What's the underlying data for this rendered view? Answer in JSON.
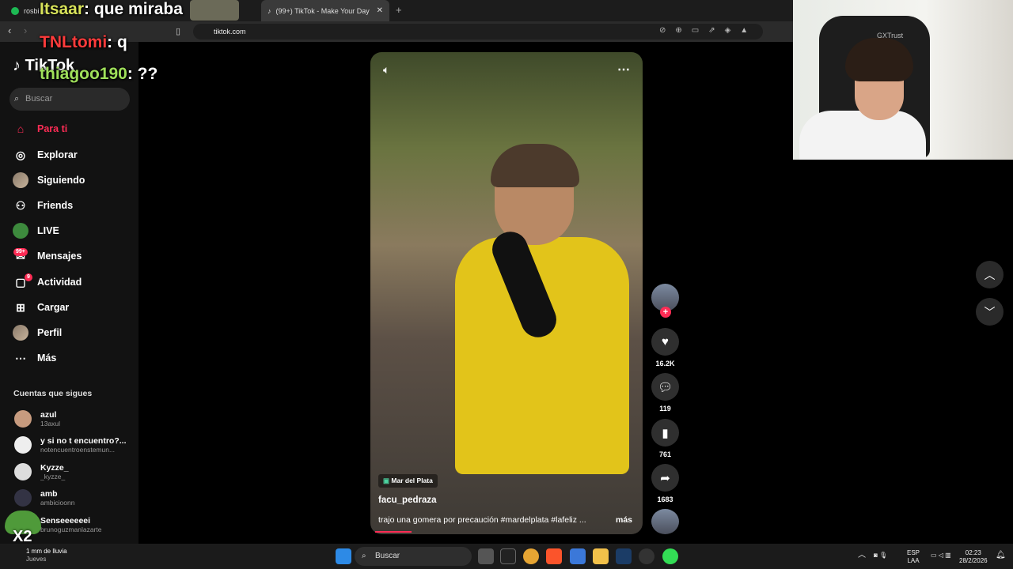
{
  "browser": {
    "tabs": [
      {
        "label": "rosbi p"
      },
      {
        "label": "(99+) TikTok - Make Your Day"
      }
    ],
    "url": "tiktok.com"
  },
  "chat_overlay": [
    {
      "user": "Itsaar",
      "message": ": que miraba",
      "color": "#d8e35a"
    },
    {
      "user": "TNLtomi",
      "message": ": q",
      "color": "#ff3b3b"
    },
    {
      "user": "thiagoo190",
      "message": ": ??",
      "color": "#9fe05a"
    }
  ],
  "sidebar": {
    "logo": "TikTok",
    "search_placeholder": "Buscar",
    "nav": [
      {
        "label": "Para ti",
        "icon": "home-icon"
      },
      {
        "label": "Explorar",
        "icon": "compass-icon"
      },
      {
        "label": "Siguiendo",
        "icon": "following-avatar-icon"
      },
      {
        "label": "Friends",
        "icon": "friends-icon"
      },
      {
        "label": "LIVE",
        "icon": "live-icon"
      },
      {
        "label": "Mensajes",
        "icon": "messages-icon",
        "badge": "99+"
      },
      {
        "label": "Actividad",
        "icon": "activity-icon",
        "badge": "9"
      },
      {
        "label": "Cargar",
        "icon": "upload-icon"
      },
      {
        "label": "Perfil",
        "icon": "profile-avatar-icon"
      },
      {
        "label": "Más",
        "icon": "more-dots-icon"
      }
    ],
    "following_title": "Cuentas que sigues",
    "following": [
      {
        "name": "azul",
        "user": "13axul"
      },
      {
        "name": "y si no t encuentro?...",
        "user": "notencuentroenstemun..."
      },
      {
        "name": "Kyzze_",
        "user": "_kyzze_"
      },
      {
        "name": "amb",
        "user": "ambicioonn"
      },
      {
        "name": "Senseeeeeei",
        "user": "brunoguzmanlazarte"
      }
    ]
  },
  "video": {
    "location": "Mar del Plata",
    "author": "facu_pedraza",
    "caption": "trajo una gomera por precaución #mardelplata  #lafeliz ...",
    "more": "más"
  },
  "actions": {
    "likes": "16.2K",
    "comments": "119",
    "saves": "761",
    "shares": "1683"
  },
  "webcam": {
    "chair_brand": "GXTrust"
  },
  "overlay_emote": {
    "label": "X2"
  },
  "taskbar": {
    "weather": "1 mm de lluvia",
    "weather_day": "Jueves",
    "search": "Buscar",
    "lang": "ESP",
    "lang2": "LAA",
    "time": "02:23",
    "date": "28/2/2026"
  }
}
